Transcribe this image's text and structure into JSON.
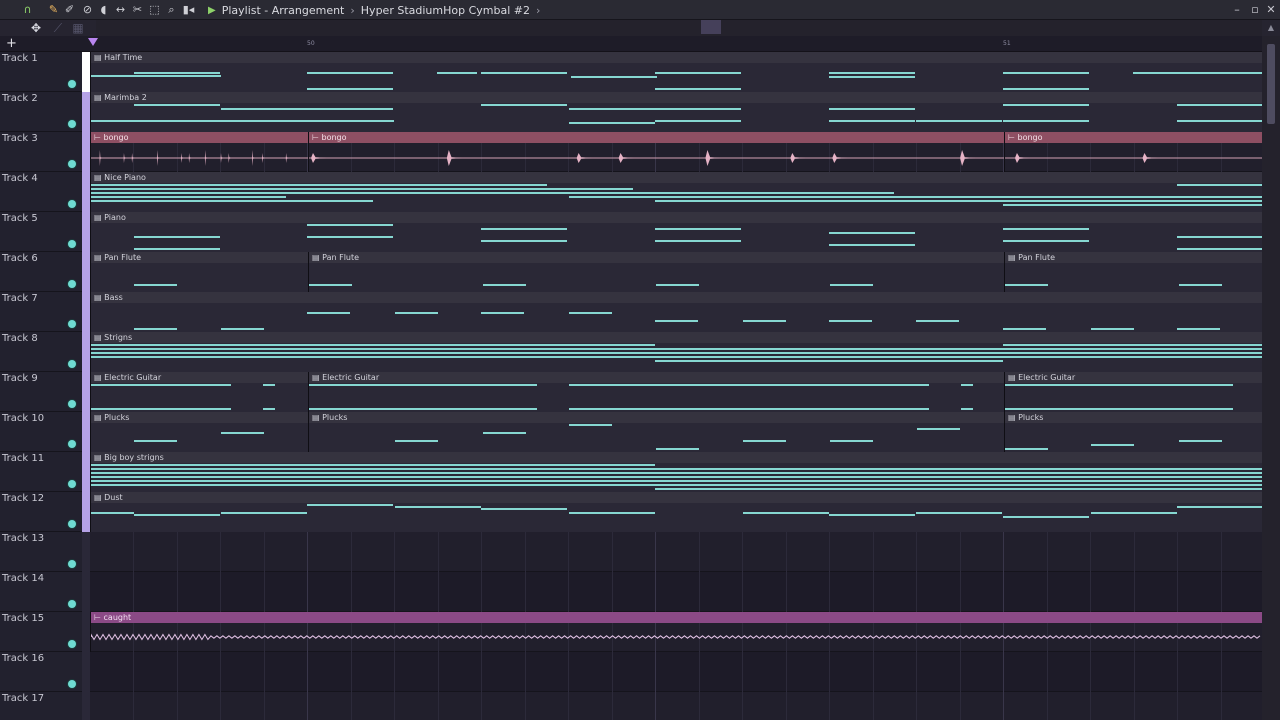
{
  "titlebar": {
    "section": "Playlist - Arrangement",
    "pattern": "Hyper StadiumHop Cymbal #2",
    "play_symbol": "▶",
    "breadcrumb_sep": "›",
    "icons": [
      "magnet-icon",
      "pencil-icon",
      "brush-icon",
      "delete-icon",
      "mute-icon",
      "slip-icon",
      "slice-icon",
      "select-icon",
      "zoom-icon",
      "playback-icon"
    ]
  },
  "window": {
    "minimize": "–",
    "maximize": "▫",
    "close": "✕"
  },
  "subbar": {
    "add": "+"
  },
  "ruler": {
    "bar_a": "50",
    "bar_b": "51"
  },
  "colors": {
    "note": "#86d7d1",
    "audio_header": "#8e4f63",
    "caught_header": "#8b4a86",
    "led": "#6fdbd2"
  },
  "tracks": [
    {
      "name": "Track 1"
    },
    {
      "name": "Track 2"
    },
    {
      "name": "Track 3"
    },
    {
      "name": "Track 4"
    },
    {
      "name": "Track 5"
    },
    {
      "name": "Track 6"
    },
    {
      "name": "Track 7"
    },
    {
      "name": "Track 8"
    },
    {
      "name": "Track 9"
    },
    {
      "name": "Track 10"
    },
    {
      "name": "Track 11"
    },
    {
      "name": "Track 12"
    },
    {
      "name": "Track 13"
    },
    {
      "name": "Track 14"
    },
    {
      "name": "Track 15"
    },
    {
      "name": "Track 16"
    },
    {
      "name": "Track 17"
    }
  ],
  "clips": {
    "half_time": "Half Time",
    "marimba": "Marimba 2",
    "bongo": "bongo",
    "nice_piano": "Nice Piano",
    "piano": "Piano",
    "pan_flute": "Pan Flute",
    "bass": "Bass",
    "strings": "Strigns",
    "electric_guitar": "Electric Guitar",
    "plucks": "Plucks",
    "big_boy": "Big boy strigns",
    "dust": "Dust",
    "caught": "caught"
  }
}
